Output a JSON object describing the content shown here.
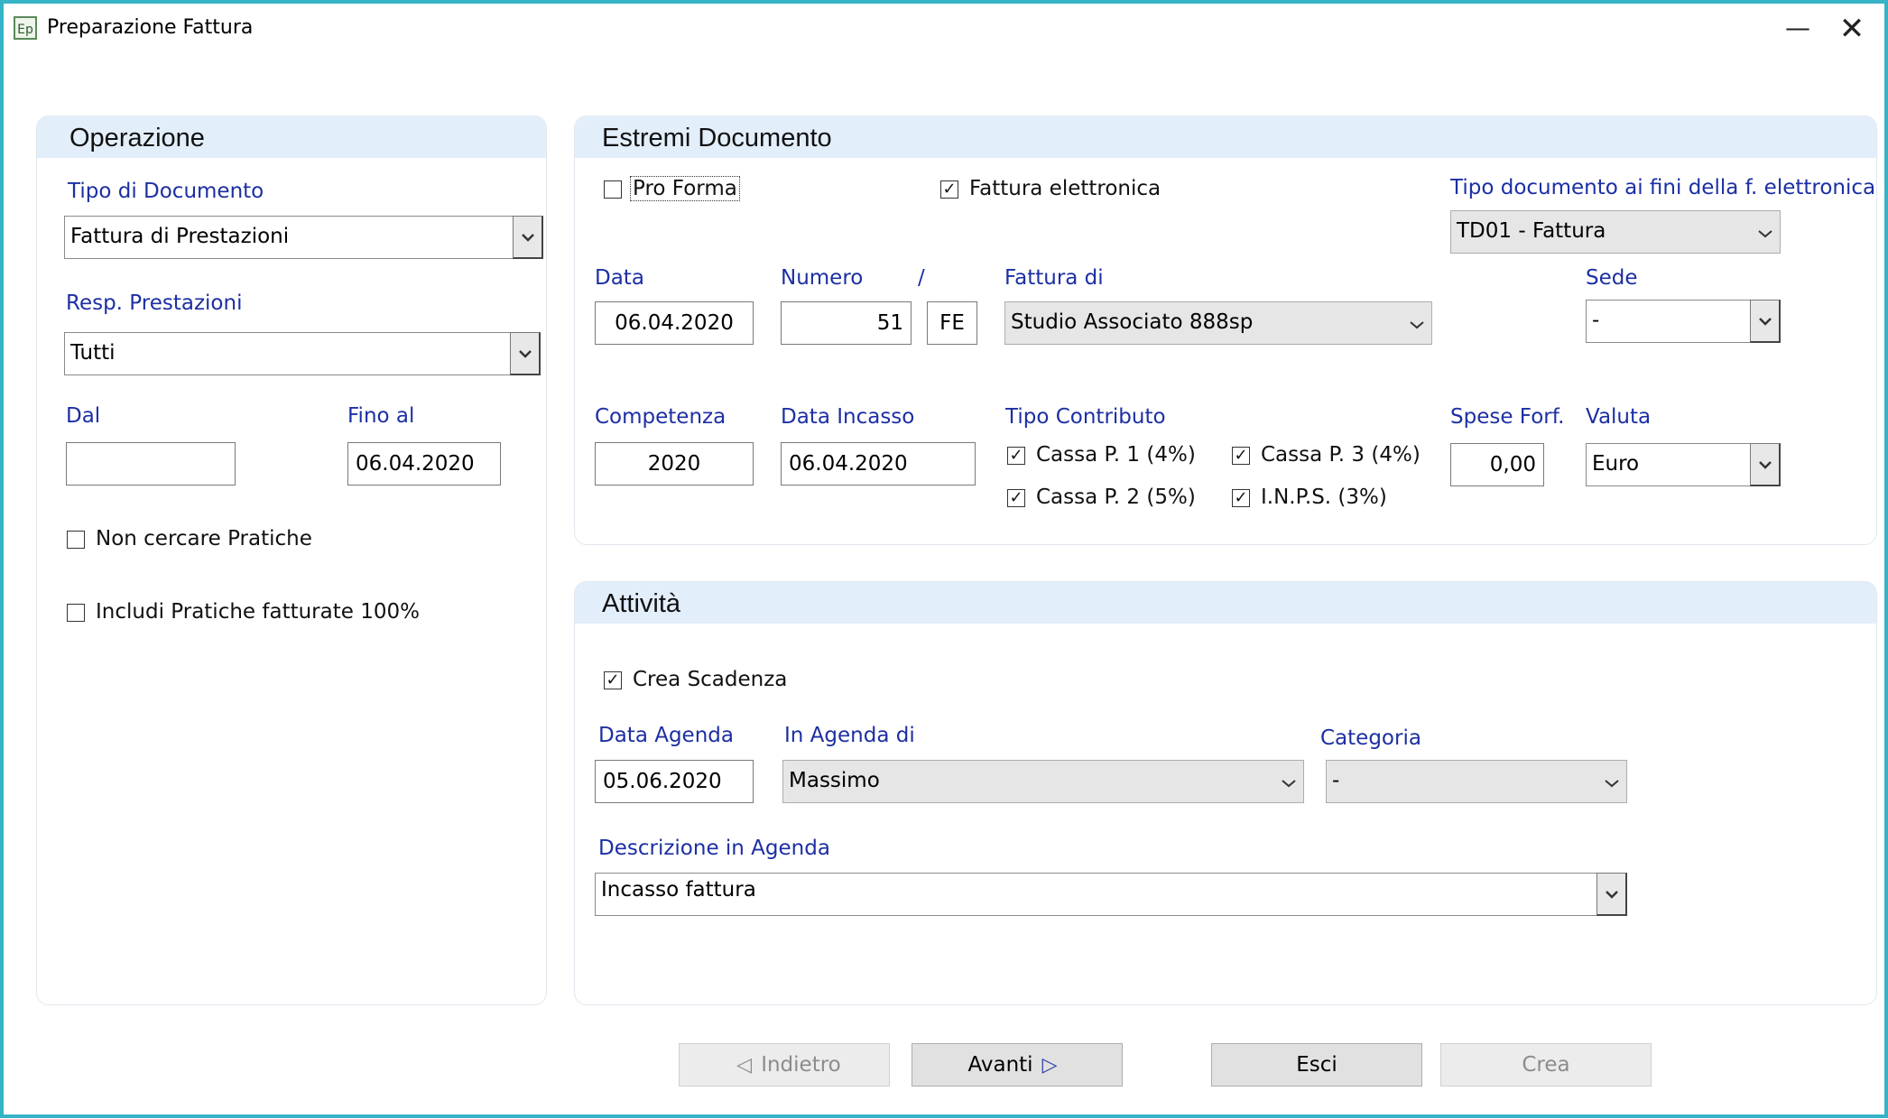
{
  "window": {
    "title": "Preparazione Fattura",
    "icon": "Ep",
    "minimize_glyph": "—",
    "close_glyph": "✕"
  },
  "operazione": {
    "header": "Operazione",
    "tipo_documento_label": "Tipo di Documento",
    "tipo_documento_value": "Fattura di Prestazioni",
    "resp_prestazioni_label": "Resp. Prestazioni",
    "resp_prestazioni_value": "Tutti",
    "dal_label": "Dal",
    "dal_value": "",
    "fino_al_label": "Fino al",
    "fino_al_value": "06.04.2020",
    "non_cercare_label": "Non cercare Pratiche",
    "non_cercare_checked": false,
    "includi_label": "Includi Pratiche fatturate 100%",
    "includi_checked": false
  },
  "estremi": {
    "header": "Estremi Documento",
    "pro_forma_label": "Pro Forma",
    "pro_forma_checked": false,
    "fattura_elettronica_label": "Fattura elettronica",
    "fattura_elettronica_checked": true,
    "tipo_doc_fe_label": "Tipo documento ai fini della f. elettronica",
    "tipo_doc_fe_value": "TD01 - Fattura",
    "data_label": "Data",
    "data_value": "06.04.2020",
    "numero_label": "Numero",
    "slash": "/",
    "numero_value": "51",
    "sezionale_value": "FE",
    "fattura_di_label": "Fattura di",
    "fattura_di_value": "Studio Associato 888sp",
    "sede_label": "Sede",
    "sede_value": "-",
    "competenza_label": "Competenza",
    "competenza_value": "2020",
    "data_incasso_label": "Data Incasso",
    "data_incasso_value": "06.04.2020",
    "tipo_contributo_label": "Tipo Contributo",
    "contributi": [
      {
        "label": "Cassa P. 1 (4%)",
        "checked": true
      },
      {
        "label": "Cassa P. 2 (5%)",
        "checked": true
      },
      {
        "label": "Cassa P. 3 (4%)",
        "checked": true
      },
      {
        "label": "I.N.P.S. (3%)",
        "checked": true
      }
    ],
    "spese_forf_label": "Spese Forf.",
    "spese_forf_value": "0,00",
    "valuta_label": "Valuta",
    "valuta_value": "Euro"
  },
  "attivita": {
    "header": "Attività",
    "crea_scadenza_label": "Crea Scadenza",
    "crea_scadenza_checked": true,
    "data_agenda_label": "Data Agenda",
    "data_agenda_value": "05.06.2020",
    "in_agenda_di_label": "In Agenda di",
    "in_agenda_di_value": "Massimo",
    "categoria_label": "Categoria",
    "categoria_value": "-",
    "descrizione_label": "Descrizione in Agenda",
    "descrizione_value": "Incasso fattura"
  },
  "buttons": {
    "indietro": "Indietro",
    "avanti": "Avanti",
    "esci": "Esci",
    "crea": "Crea"
  },
  "glyphs": {
    "check": "✓",
    "dropdown": "⌄",
    "left_triangle": "◁",
    "right_triangle": "▷"
  }
}
